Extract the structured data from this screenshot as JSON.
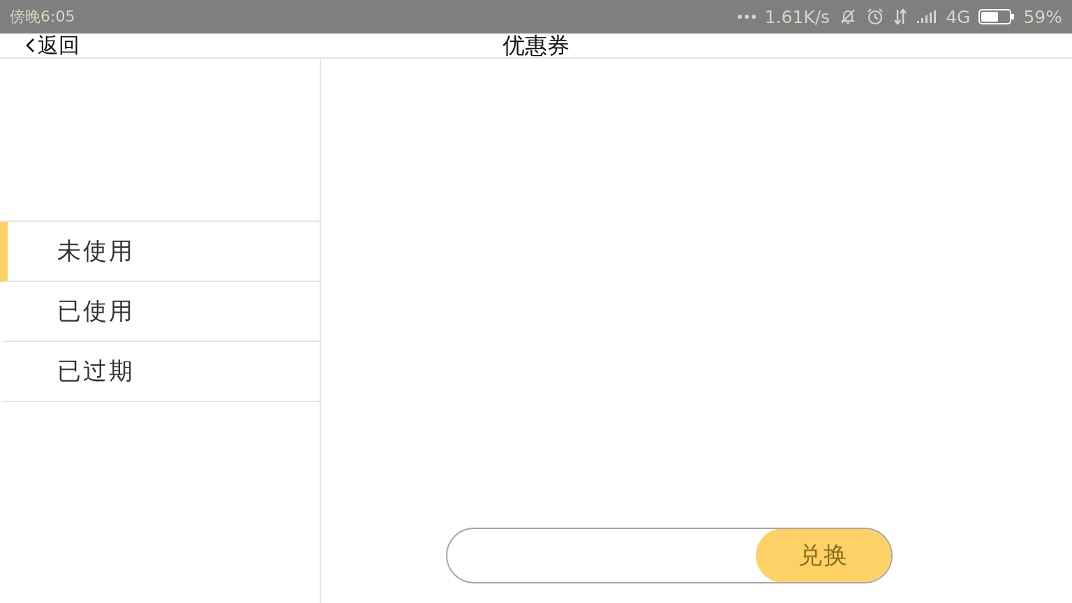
{
  "status_bar": {
    "time": "傍晚6:05",
    "network_speed": "1.61K/s",
    "network_type": "4G",
    "battery": "59%"
  },
  "header": {
    "back": "返回",
    "title": "优惠券"
  },
  "tabs": [
    {
      "label": "未使用",
      "selected": true
    },
    {
      "label": "已使用",
      "selected": false
    },
    {
      "label": "已过期",
      "selected": false
    }
  ],
  "redeem": {
    "button": "兑换"
  }
}
